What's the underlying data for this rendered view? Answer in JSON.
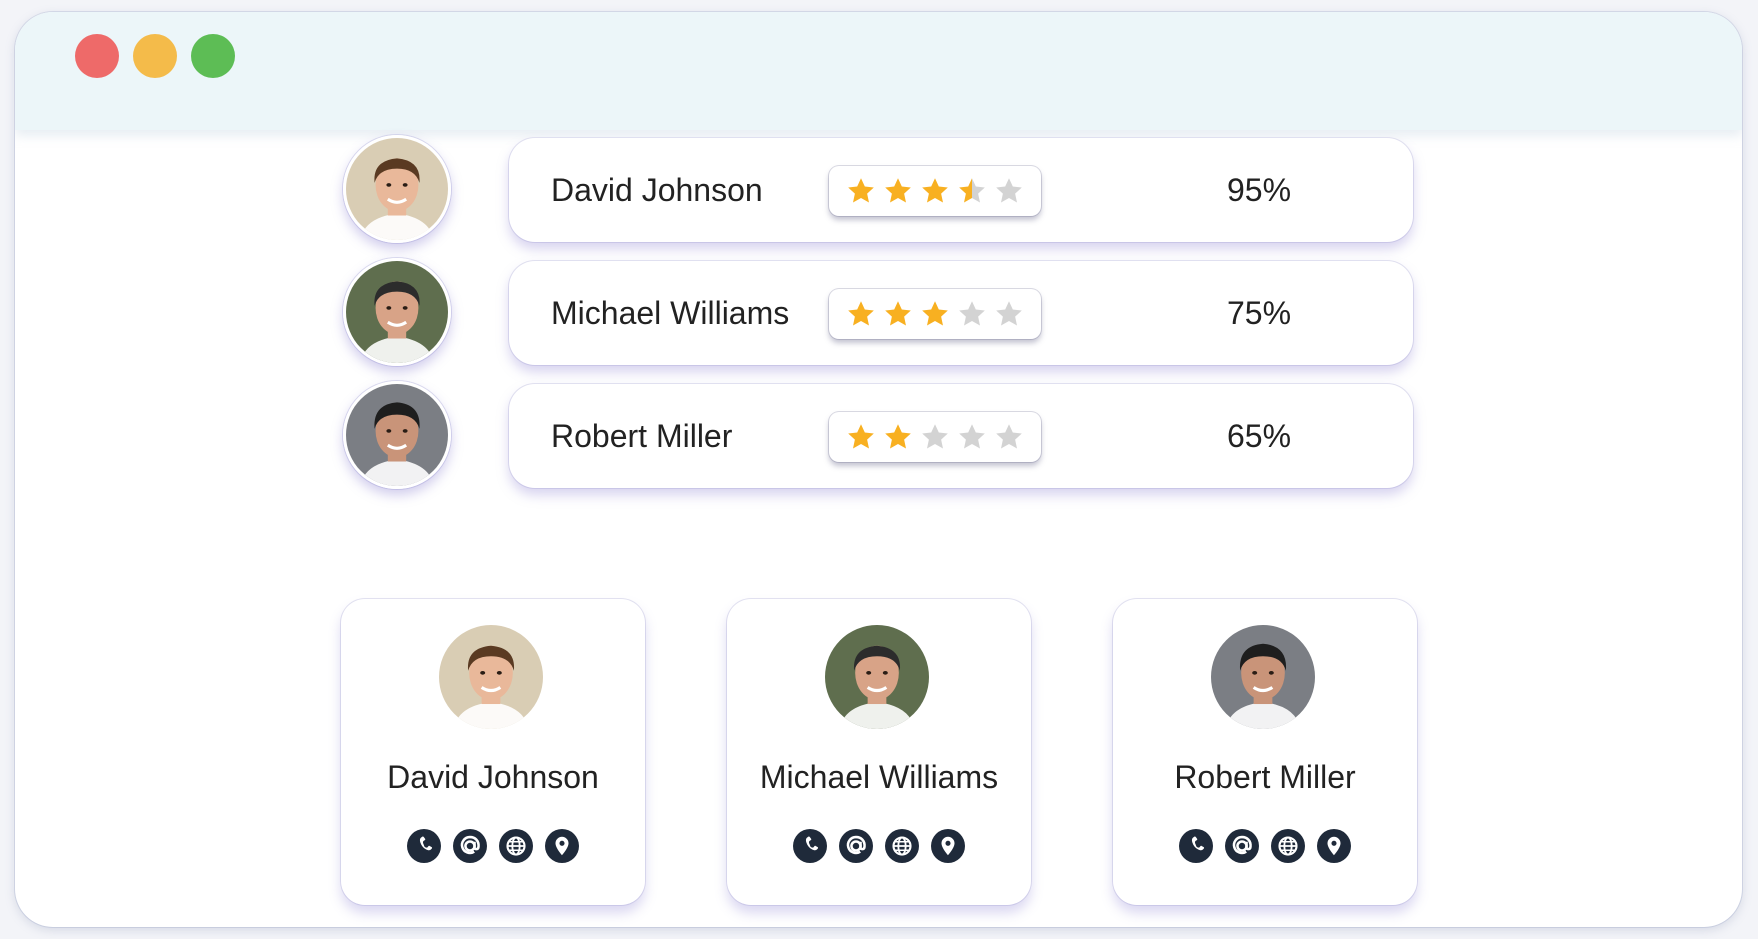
{
  "window": {
    "controls": [
      {
        "name": "close",
        "color": "#ee6a69"
      },
      {
        "name": "minimize",
        "color": "#f4bb4a"
      },
      {
        "name": "maximize",
        "color": "#5dbd55"
      }
    ]
  },
  "ratings": [
    {
      "name": "David Johnson",
      "stars": 3.5,
      "max_stars": 5,
      "percent": "95%"
    },
    {
      "name": "Michael Williams",
      "stars": 3,
      "max_stars": 5,
      "percent": "75%"
    },
    {
      "name": "Robert Miller",
      "stars": 2,
      "max_stars": 5,
      "percent": "65%"
    }
  ],
  "profiles": [
    {
      "name": "David Johnson",
      "icons": [
        "phone-icon",
        "email-icon",
        "globe-icon",
        "location-icon"
      ]
    },
    {
      "name": "Michael Williams",
      "icons": [
        "phone-icon",
        "email-icon",
        "globe-icon",
        "location-icon"
      ]
    },
    {
      "name": "Robert Miller",
      "icons": [
        "phone-icon",
        "email-icon",
        "globe-icon",
        "location-icon"
      ]
    }
  ],
  "colors": {
    "star_filled": "#f8b021",
    "star_empty": "#d3d3d3",
    "icon_bg": "#1f2a3a",
    "titlebar_bg": "#ecf6f9"
  }
}
